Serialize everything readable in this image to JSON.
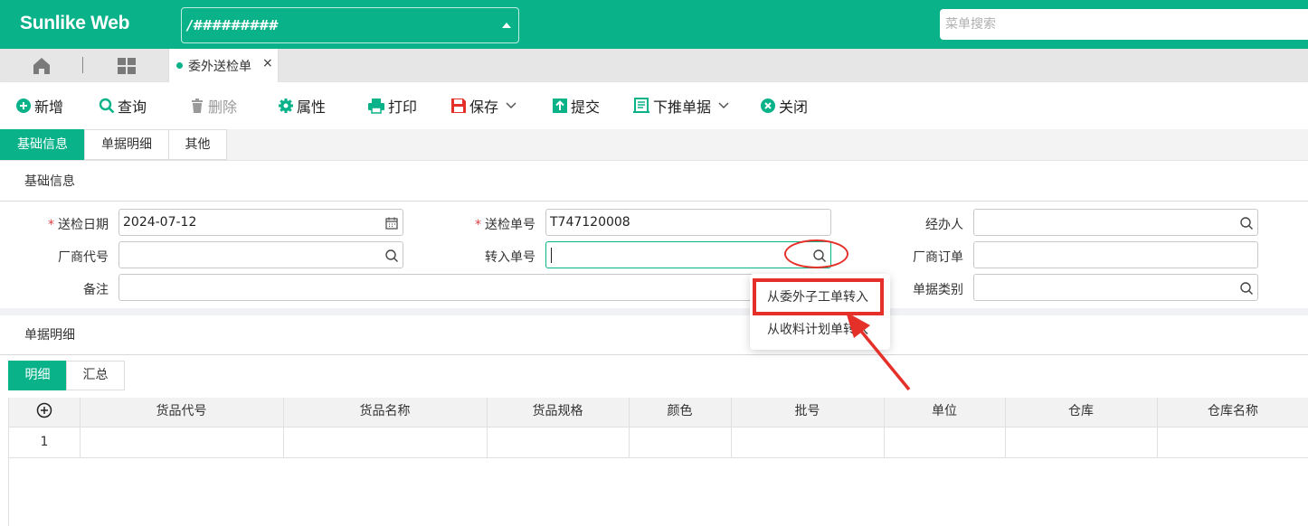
{
  "header": {
    "brand": "Sunlike Web",
    "org_value": "/#########",
    "menu_search_placeholder": "菜单搜索"
  },
  "tabs": {
    "active_doc": "委外送检单",
    "close_glyph": "×"
  },
  "toolbar": {
    "new": "新增",
    "query": "查询",
    "delete": "删除",
    "props": "属性",
    "print": "打印",
    "save": "保存",
    "submit": "提交",
    "push_down": "下推单据",
    "close": "关闭"
  },
  "section_tabs": [
    "基础信息",
    "单据明细",
    "其他"
  ],
  "basic": {
    "group_title": "基础信息",
    "fields": {
      "inspect_date_label": "送检日期",
      "inspect_date_value": "2024-07-12",
      "inspect_no_label": "送检单号",
      "inspect_no_value": "T747120008",
      "handler_label": "经办人",
      "vendor_label": "厂商代号",
      "transfer_no_label": "转入单号",
      "vendor_order_label": "厂商订单",
      "remark_label": "备注",
      "doc_type_label": "单据类别"
    }
  },
  "dropdown": {
    "items": [
      "从委外子工单转入",
      "从收料计划单转入"
    ]
  },
  "detail": {
    "group_title": "单据明细",
    "subtabs": [
      "明细",
      "汇总"
    ],
    "columns": [
      "货品代号",
      "货品名称",
      "货品规格",
      "颜色",
      "批号",
      "单位",
      "仓库",
      "仓库名称"
    ],
    "rows": [
      {
        "no": "1"
      }
    ],
    "add_glyph": "⊕"
  },
  "colors": {
    "brand": "#0ab28a",
    "highlight": "#e5302a"
  }
}
